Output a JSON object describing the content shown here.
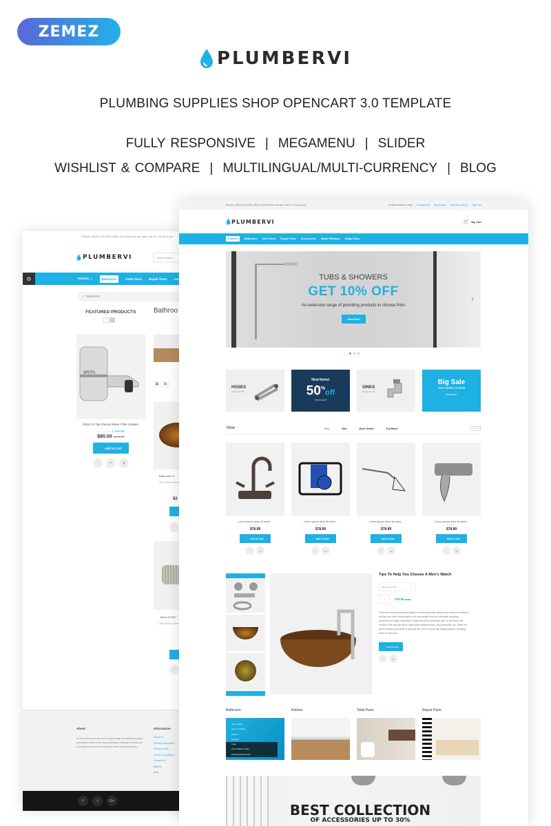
{
  "brand": {
    "badge": "ZEMEZ",
    "logo": "PLUMBERVI",
    "accent": "#1eb1e3",
    "dark_banner": "#1a3a5c"
  },
  "headline": "PLUMBING SUPPLIES SHOP OPENCART 3.0 TEMPLATE",
  "features_line1": [
    "FULLY RESPONSIVE",
    "MEGAMENU",
    "SLIDER"
  ],
  "features_line2": [
    "WISHLIST & COMPARE",
    "MULTILINGUAL/MULTI-CURRENCY",
    "BLOG"
  ],
  "separator": "|",
  "left_mock": {
    "topbar": "Phones: (800) 123-0045; (800) 123-0046   We are open: Mn-Fr: 10 am-8 pm",
    "search_placeholder": "Search entire",
    "nav": [
      "Kitchen ⌄",
      "Bathroom",
      "Toilet Parts",
      "Repair Parts",
      "Acce"
    ],
    "breadcrumb": "› Bathroom",
    "featured_title": "FEATURED PRODUCTS",
    "page_heading": "Bathroo",
    "product": {
      "name": "Brita On Tap Faucet Water Filter System",
      "stars": "☆☆☆☆☆",
      "reviews": "1 reviews",
      "price": "$80.00",
      "old_price": "$100.00",
      "cart": "Add to Cart"
    },
    "col2": {
      "name1": "Bathroom Te",
      "desc1": "One of the le plumbing. All h",
      "price1": "$2",
      "name2": "Moen A7200",
      "desc2": "One of the le plumbing. All h"
    },
    "footer": {
      "about_title": "About",
      "about_text": "At our online store we have a huge range of plumbing supplies and tools to take on the most plumbing challenges so that you can keep your home and sanitary ware running smoothly.",
      "info_title": "Information",
      "info_links": [
        "About Us",
        "Delivery Information",
        "Privacy Policy",
        "Terms & Conditions",
        "Contact Us",
        "Returns",
        "Blog"
      ],
      "social": [
        "f",
        "t",
        "G+"
      ]
    }
  },
  "right_mock": {
    "topbar_left": "Phones: (800) 123-0045; (800) 123-0046    We are open: Mn-Fr: 10 am-8 pm",
    "welcome": "Default welcome msg!",
    "top_links": [
      "Compare (0)",
      "My Account",
      "My Wish List (0)",
      "Sign Out"
    ],
    "cart_label": "My Cart",
    "cart_count": "0",
    "nav": [
      "Kitchen",
      "Bathroom",
      "Toilet Parts",
      "Repair Parts",
      "Accessories",
      "Water Filtration",
      "Utility Sinks"
    ],
    "slider": {
      "line1": "TUBS & SHOWERS",
      "line2": "GET 10% OFF",
      "line3": "An extensive range of plumbing products to choose from",
      "button": "Shop Now!",
      "active_slide": 1,
      "slides": 3
    },
    "banners": [
      {
        "title": "HOSES",
        "sub": "Starting at $ 375"
      },
      {
        "top": "New Items!",
        "big": "50",
        "pct": "%",
        "off": "off",
        "sub": "Only this week!"
      },
      {
        "title": "SINKS",
        "sub": "Starting at $ 375"
      },
      {
        "top": "Big Sale",
        "sub": "Now Startin at $199",
        "btn": "Shop Now!"
      }
    ],
    "products_section": {
      "title": "New",
      "tabs": [
        "New",
        "Sale",
        "Most Viewed",
        "Top Rated"
      ],
      "active_tab": 0
    },
    "products": [
      {
        "name": "Lorem ipsum dolor sit amet...",
        "stars": "★★★★☆",
        "price": "$78.89",
        "cart": "Add to Cart"
      },
      {
        "name": "Lorem ipsum dolor sit amet...",
        "stars": "★★★★☆",
        "price": "$78.89",
        "cart": "Add to Cart"
      },
      {
        "name": "Lorem ipsum dolor sit amet...",
        "stars": "★★★★☆",
        "price": "$78.89",
        "cart": "Add to Cart"
      },
      {
        "name": "Lorem ipsum dolor sit amet...",
        "stars": "★★★★☆",
        "price": "$78.89",
        "cart": "Add to Cart"
      }
    ],
    "quickview": {
      "title": "Tips To Help You Choose A Men's Watch",
      "select_placeholder": "Choose your size",
      "qty": "1",
      "price": "$78.89",
      "old_price": "$89.96",
      "desc": "There are so many elements today in our lives that make things more and more hectic by the day, and there hardly seems to be any respite from the constantly mounting... pressures and tough competition to stay ahead of everybody, plan for the future, etc. However, this has also led to rising stress-related issues, blood pressure, etc. While one cannot simply sit at home to avoid all this, a bit of humor has always helped in bringing cheer to one's day.",
      "cart": "Add To Cart"
    },
    "categories": [
      {
        "label": "Bathroom",
        "list": [
          "Crane Toilets",
          "Home & Garden",
          "Kitchen",
          "Showers",
          "Tools",
          "Tub & Shower Seats",
          "Plumbing Repair Parts"
        ]
      },
      {
        "label": "Kitchen"
      },
      {
        "label": "Toilet Parts"
      },
      {
        "label": "Repair Parts"
      }
    ],
    "promo": {
      "line1": "BEST COLLECTION",
      "line2": "OF ACCESSORIES UP TO 30%"
    }
  }
}
